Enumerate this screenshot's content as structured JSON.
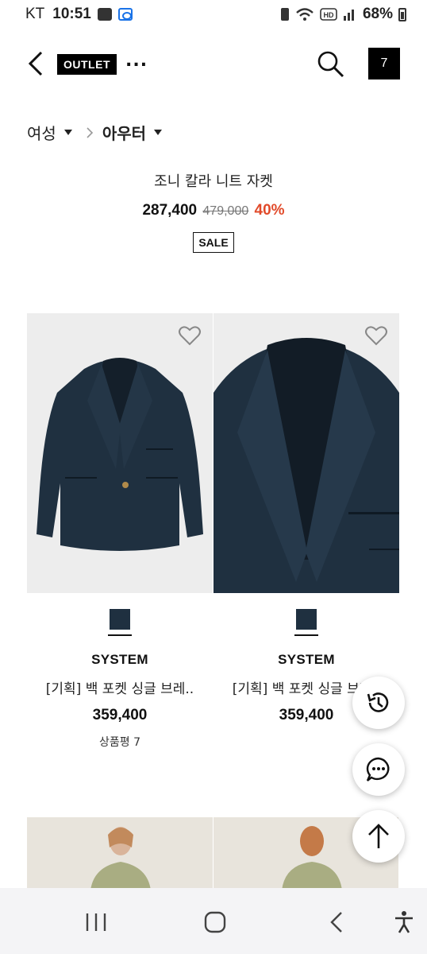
{
  "status_bar": {
    "carrier": "KT",
    "time": "10:51",
    "battery_percent": "68%",
    "icons": [
      "gallery-icon",
      "app-icon",
      "sim-icon",
      "wifi-icon",
      "hd-icon",
      "signal-icon",
      "battery-icon"
    ]
  },
  "header": {
    "outlet_label": "OUTLET",
    "more_label": "...",
    "cart_count": "7"
  },
  "breadcrumb": {
    "parent": "여성",
    "current": "아우터"
  },
  "promo": {
    "title": "조니 칼라 니트 자켓",
    "price": "287,400",
    "original_price": "479,000",
    "discount": "40%",
    "badge": "SALE"
  },
  "products": [
    {
      "brand": "SYSTEM",
      "name": "[기획] 백 포켓 싱글 브레..",
      "price": "359,400",
      "review": "상품평 7",
      "swatch_color": "#1f3040"
    },
    {
      "brand": "SYSTEM",
      "name": "[기획] 백 포켓 싱글 브레..",
      "price": "359,400",
      "swatch_color": "#1f3040"
    }
  ],
  "colors": {
    "discount": "#e14a2a",
    "jacket_navy": "#1f3040"
  }
}
